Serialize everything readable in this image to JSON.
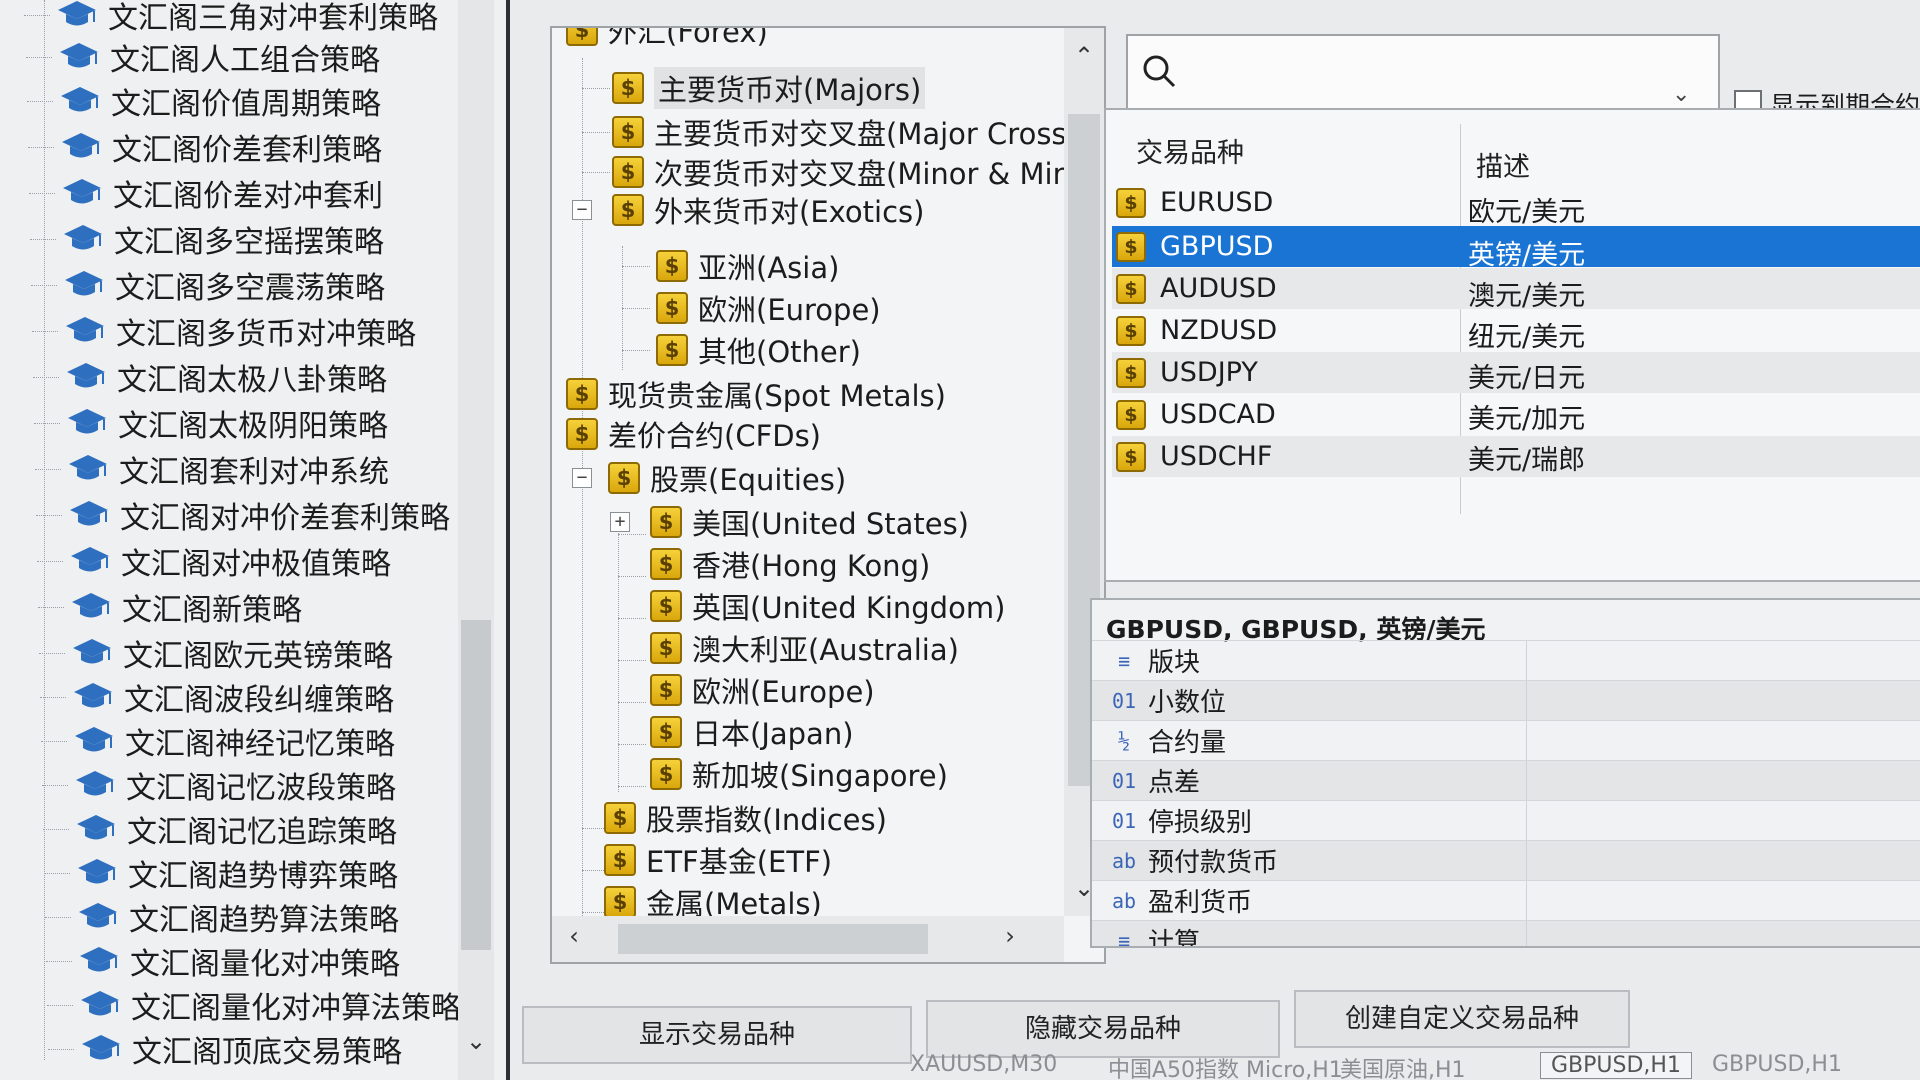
{
  "strategies": {
    "items": [
      {
        "label": "文汇阁三角对冲套利策略"
      },
      {
        "label": "文汇阁人工组合策略"
      },
      {
        "label": "文汇阁价值周期策略"
      },
      {
        "label": "文汇阁价差套利策略"
      },
      {
        "label": "文汇阁价差对冲套利"
      },
      {
        "label": "文汇阁多空摇摆策略"
      },
      {
        "label": "文汇阁多空震荡策略"
      },
      {
        "label": "文汇阁多货币对冲策略"
      },
      {
        "label": "文汇阁太极八卦策略"
      },
      {
        "label": "文汇阁太极阴阳策略"
      },
      {
        "label": "文汇阁套利对冲系统"
      },
      {
        "label": "文汇阁对冲价差套利策略"
      },
      {
        "label": "文汇阁对冲极值策略"
      },
      {
        "label": "文汇阁新策略"
      },
      {
        "label": "文汇阁欧元英镑策略"
      },
      {
        "label": "文汇阁波段纠缠策略"
      },
      {
        "label": "文汇阁神经记忆策略"
      },
      {
        "label": "文汇阁记忆波段策略"
      },
      {
        "label": "文汇阁记忆追踪策略"
      },
      {
        "label": "文汇阁趋势博弈策略"
      },
      {
        "label": "文汇阁趋势算法策略"
      },
      {
        "label": "文汇阁量化对冲策略"
      },
      {
        "label": "文汇阁量化对冲算法策略"
      },
      {
        "label": "文汇阁顶底交易策略"
      }
    ],
    "icon": "graduation-cap-icon",
    "icon_color": "#2e6fc0"
  },
  "tree": {
    "nodes": [
      {
        "label": "外汇(Forex)"
      },
      {
        "label": "主要货币对(Majors)"
      },
      {
        "label": "主要货币对交叉盘(Major Crosses)"
      },
      {
        "label": "次要货币对交叉盘(Minor & Minor"
      },
      {
        "label": "外来货币对(Exotics)"
      },
      {
        "label": "亚洲(Asia)"
      },
      {
        "label": "欧洲(Europe)"
      },
      {
        "label": "其他(Other)"
      },
      {
        "label": "现货贵金属(Spot Metals)"
      },
      {
        "label": "差价合约(CFDs)"
      },
      {
        "label": "股票(Equities)"
      },
      {
        "label": "美国(United States)"
      },
      {
        "label": "香港(Hong Kong)"
      },
      {
        "label": "英国(United Kingdom)"
      },
      {
        "label": "澳大利亚(Australia)"
      },
      {
        "label": "欧洲(Europe)"
      },
      {
        "label": "日本(Japan)"
      },
      {
        "label": "新加坡(Singapore)"
      },
      {
        "label": "股票指数(Indices)"
      },
      {
        "label": "ETF基金(ETF)"
      },
      {
        "label": "金属(Metals)"
      }
    ],
    "coin_glyph": "$",
    "collapse_glyph": "−",
    "expand_glyph": "+"
  },
  "search": {
    "placeholder": "",
    "value": "",
    "dropdown_glyph": "⌄",
    "show_contracts_label": "显示到期合约"
  },
  "symbols": {
    "headers": {
      "symbol": "交易品种",
      "description": "描述"
    },
    "rows": [
      {
        "symbol": "EURUSD",
        "description": "欧元/美元"
      },
      {
        "symbol": "GBPUSD",
        "description": "英镑/美元"
      },
      {
        "symbol": "AUDUSD",
        "description": "澳元/美元"
      },
      {
        "symbol": "NZDUSD",
        "description": "纽元/美元"
      },
      {
        "symbol": "USDJPY",
        "description": "美元/日元"
      },
      {
        "symbol": "USDCAD",
        "description": "美元/加元"
      },
      {
        "symbol": "USDCHF",
        "description": "美元/瑞郎"
      }
    ],
    "selected_symbol": "GBPUSD",
    "selected_color": "#1a74d4"
  },
  "properties": {
    "title": "GBPUSD, GBPUSD, 英镑/美元",
    "rows": [
      {
        "icon": "≡",
        "label": "版块"
      },
      {
        "icon": "01",
        "label": "小数位"
      },
      {
        "icon": "½",
        "label": "合约量"
      },
      {
        "icon": "01",
        "label": "点差"
      },
      {
        "icon": "01",
        "label": "停损级别"
      },
      {
        "icon": "ab",
        "label": "预付款货币"
      },
      {
        "icon": "ab",
        "label": "盈利货币"
      },
      {
        "icon": "≡",
        "label": "计算"
      }
    ]
  },
  "buttons": {
    "show": "显示交易品种",
    "hide": "隐藏交易品种",
    "create": "创建自定义交易品种"
  },
  "scroll": {
    "up": "⌃",
    "down": "⌄",
    "left": "‹",
    "right": "›"
  },
  "bottom_tabs": [
    "XAUUSD,M30",
    "中国A50指数 Micro,H1",
    "美国原油,H1",
    "GBPUSD,H1",
    "GBPUSD,H1"
  ]
}
